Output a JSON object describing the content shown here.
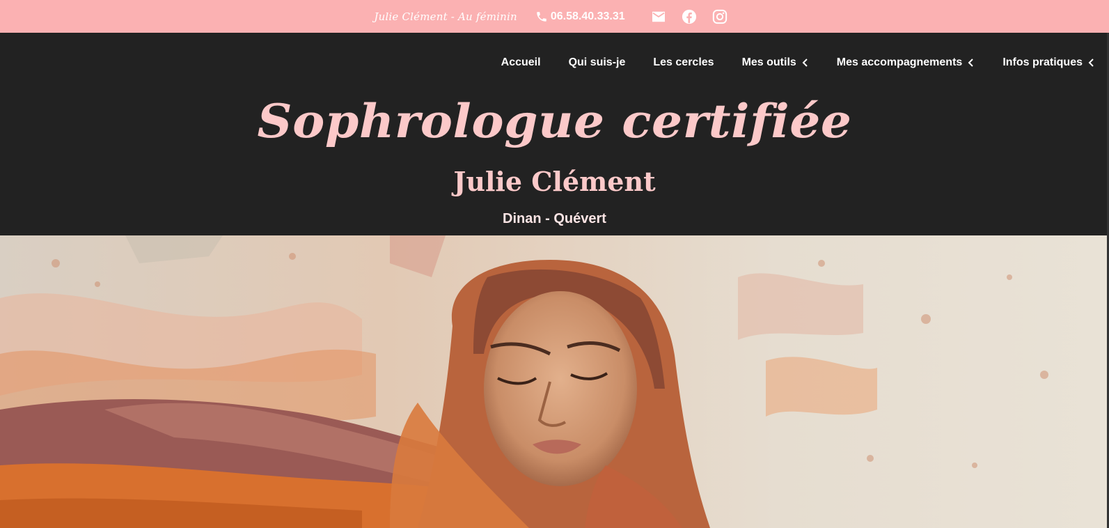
{
  "topbar": {
    "brand": "Julie Clément - Au féminin",
    "phone": "06.58.40.33.31",
    "icons": [
      "phone-icon",
      "mail-icon",
      "facebook-icon",
      "instagram-icon"
    ],
    "background": "#fbb1b2"
  },
  "nav": {
    "items": [
      {
        "label": "Accueil",
        "has_submenu": false
      },
      {
        "label": "Qui suis-je",
        "has_submenu": false
      },
      {
        "label": "Les cercles",
        "has_submenu": false
      },
      {
        "label": "Mes outils",
        "has_submenu": true
      },
      {
        "label": "Mes accompagnements",
        "has_submenu": true
      },
      {
        "label": "Infos pratiques",
        "has_submenu": true
      }
    ]
  },
  "hero": {
    "title": "Sophrologue certifiée",
    "name": "Julie Clément",
    "location": "Dinan - Quévert",
    "accent": "#fcc9c9",
    "background": "#222222"
  }
}
